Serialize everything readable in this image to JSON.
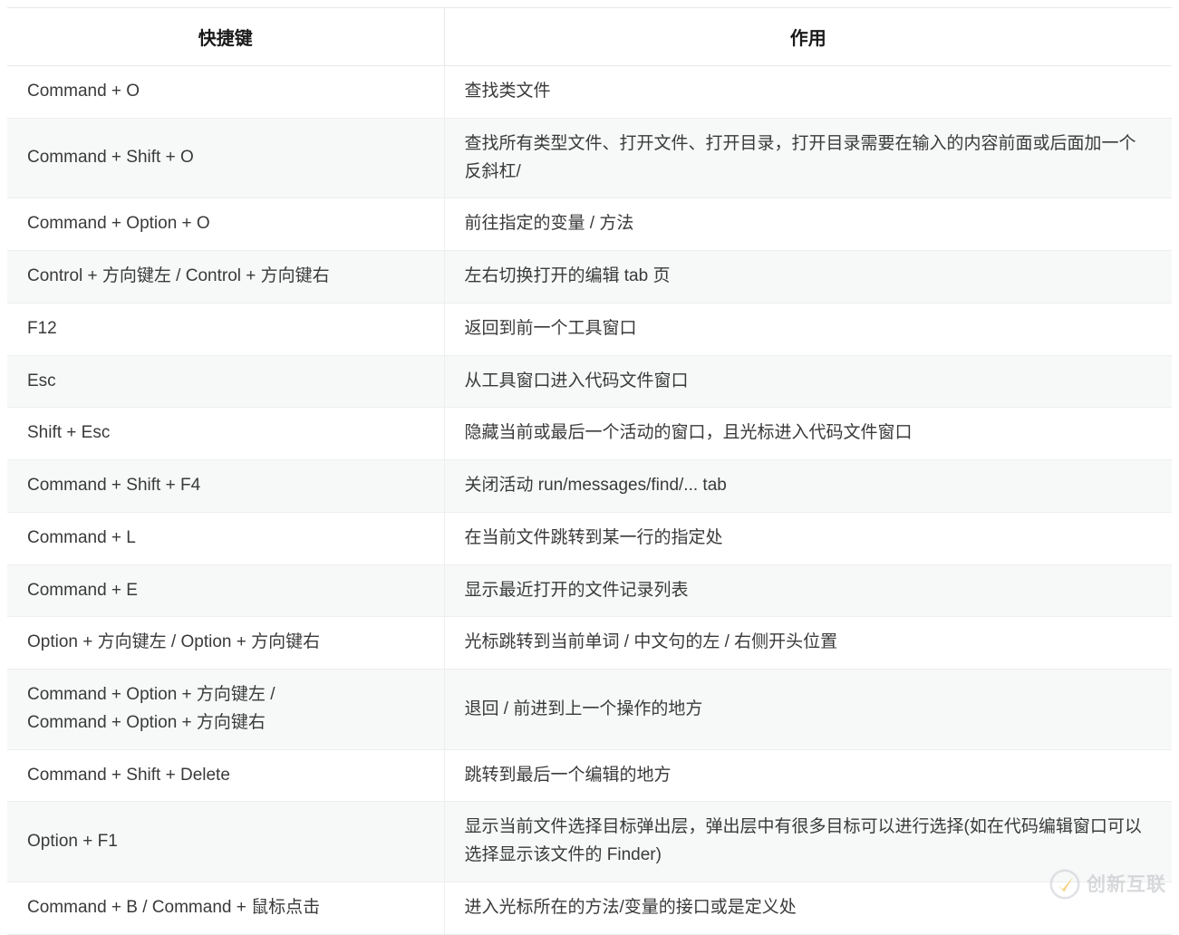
{
  "table": {
    "columns": [
      {
        "key": "shortcut",
        "label": "快捷键"
      },
      {
        "key": "action",
        "label": "作用"
      }
    ],
    "rows": [
      {
        "shortcut": "Command + O",
        "action": "查找类文件"
      },
      {
        "shortcut": "Command + Shift + O",
        "action": "查找所有类型文件、打开文件、打开目录，打开目录需要在输入的内容前面或后面加一个反斜杠/"
      },
      {
        "shortcut": "Command + Option + O",
        "action": "前往指定的变量 / 方法"
      },
      {
        "shortcut": "Control + 方向键左 / Control + 方向键右",
        "action": "左右切换打开的编辑 tab 页"
      },
      {
        "shortcut": "F12",
        "action": "返回到前一个工具窗口"
      },
      {
        "shortcut": "Esc",
        "action": "从工具窗口进入代码文件窗口"
      },
      {
        "shortcut": "Shift + Esc",
        "action": "隐藏当前或最后一个活动的窗口，且光标进入代码文件窗口"
      },
      {
        "shortcut": "Command + Shift + F4",
        "action": "关闭活动 run/messages/find/... tab"
      },
      {
        "shortcut": "Command + L",
        "action": "在当前文件跳转到某一行的指定处"
      },
      {
        "shortcut": "Command + E",
        "action": "显示最近打开的文件记录列表"
      },
      {
        "shortcut": "Option + 方向键左 / Option + 方向键右",
        "action": "光标跳转到当前单词 / 中文句的左 / 右侧开头位置"
      },
      {
        "shortcut": "Command + Option + 方向键左 /\nCommand + Option + 方向键右",
        "action": "退回 / 前进到上一个操作的地方"
      },
      {
        "shortcut": "Command + Shift + Delete",
        "action": "跳转到最后一个编辑的地方"
      },
      {
        "shortcut": "Option + F1",
        "action": "显示当前文件选择目标弹出层，弹出层中有很多目标可以进行选择(如在代码编辑窗口可以选择显示该文件的 Finder)"
      },
      {
        "shortcut": "Command + B / Command + 鼠标点击",
        "action": "进入光标所在的方法/变量的接口或是定义处"
      }
    ]
  },
  "watermark": {
    "text": "创新互联",
    "icon": "circle-check-logo-icon",
    "color": "#f0b429"
  }
}
